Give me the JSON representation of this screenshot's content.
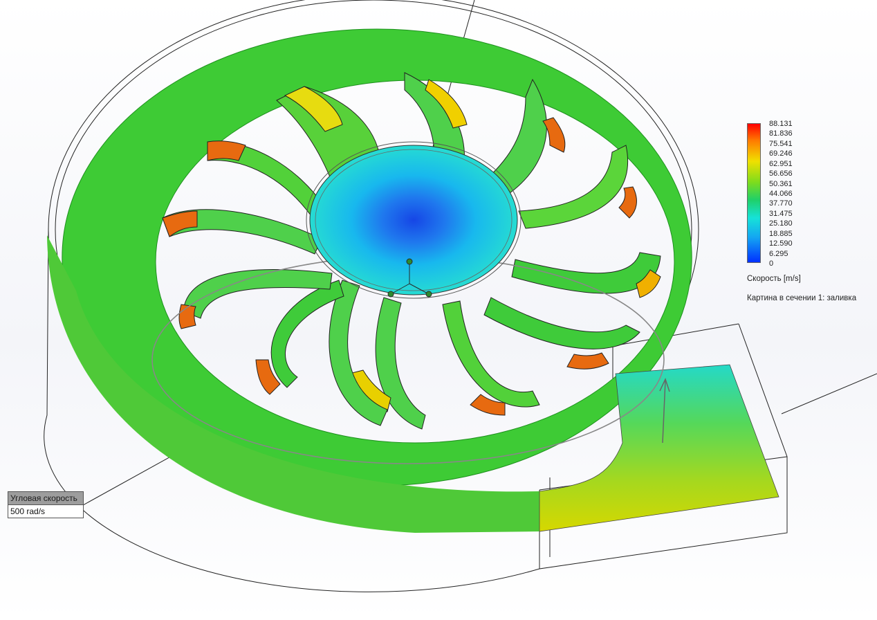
{
  "legend": {
    "ticks": [
      "88.131",
      "81.836",
      "75.541",
      "69.246",
      "62.951",
      "56.656",
      "50.361",
      "44.066",
      "37.770",
      "31.475",
      "25.180",
      "18.885",
      "12.590",
      "6.295",
      "0"
    ],
    "title": "Скорость [m/s]",
    "caption": "Картина в сечении 1: заливка",
    "colors": {
      "max": "#ff0000",
      "high": "#ff7a00",
      "midhigh": "#f0e000",
      "mid": "#3ed23a",
      "midlow": "#16e2d8",
      "low": "#14a6f2",
      "min": "#0030ff"
    }
  },
  "callout": {
    "header": "Угловая скорость",
    "value": "500 rad/s"
  },
  "icons": {
    "triad": "coordinate-triad-icon"
  }
}
